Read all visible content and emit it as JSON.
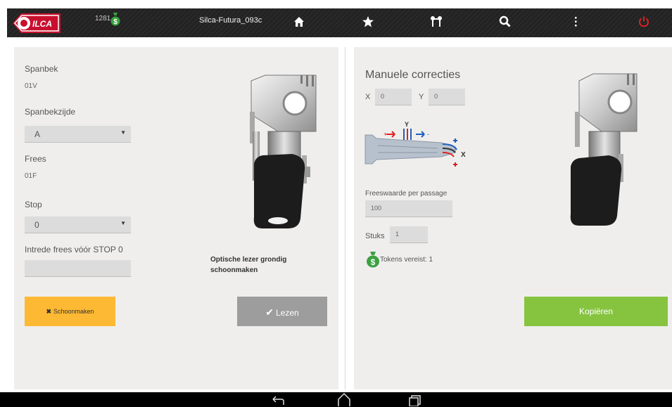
{
  "header": {
    "token_count": "1281",
    "window_title": "Silca-Futura_093c",
    "icons": [
      "home-icon",
      "star-icon",
      "key-icon",
      "search-icon",
      "more-vert-icon",
      "power-icon"
    ],
    "power_color": "#e02020",
    "money_color": "#3aa140"
  },
  "left": {
    "spanbek_label": "Spanbek",
    "spanbek_value": "01V",
    "spanbekzijde_label": "Spanbekzijde",
    "spanbekzijde_value": "A",
    "frees_label": "Frees",
    "frees_value": "01F",
    "stop_label": "Stop",
    "stop_value": "0",
    "intrede_label": "Intrede frees vóór STOP 0",
    "intrede_value": "",
    "hint_line1": "Optische lezer grondig",
    "hint_line2": "schoonmaken",
    "clean_button": "Schoonmaken",
    "read_button": "Lezen"
  },
  "right": {
    "title": "Manuele correcties",
    "x_label": "X",
    "x_value": "0",
    "y_label": "Y",
    "y_value": "0",
    "diagram_y": "Y",
    "diagram_x": "X",
    "passage_label": "Freeswaarde per passage",
    "passage_value": "100",
    "stuks_label": "Stuks",
    "stuks_value": "1",
    "tokens_text": "Tokens vereist: 1",
    "copy_button": "Kopiëren"
  },
  "colors": {
    "accent_yellow": "#fdb933",
    "accent_green": "#86c440",
    "button_grey": "#9d9d9d"
  }
}
